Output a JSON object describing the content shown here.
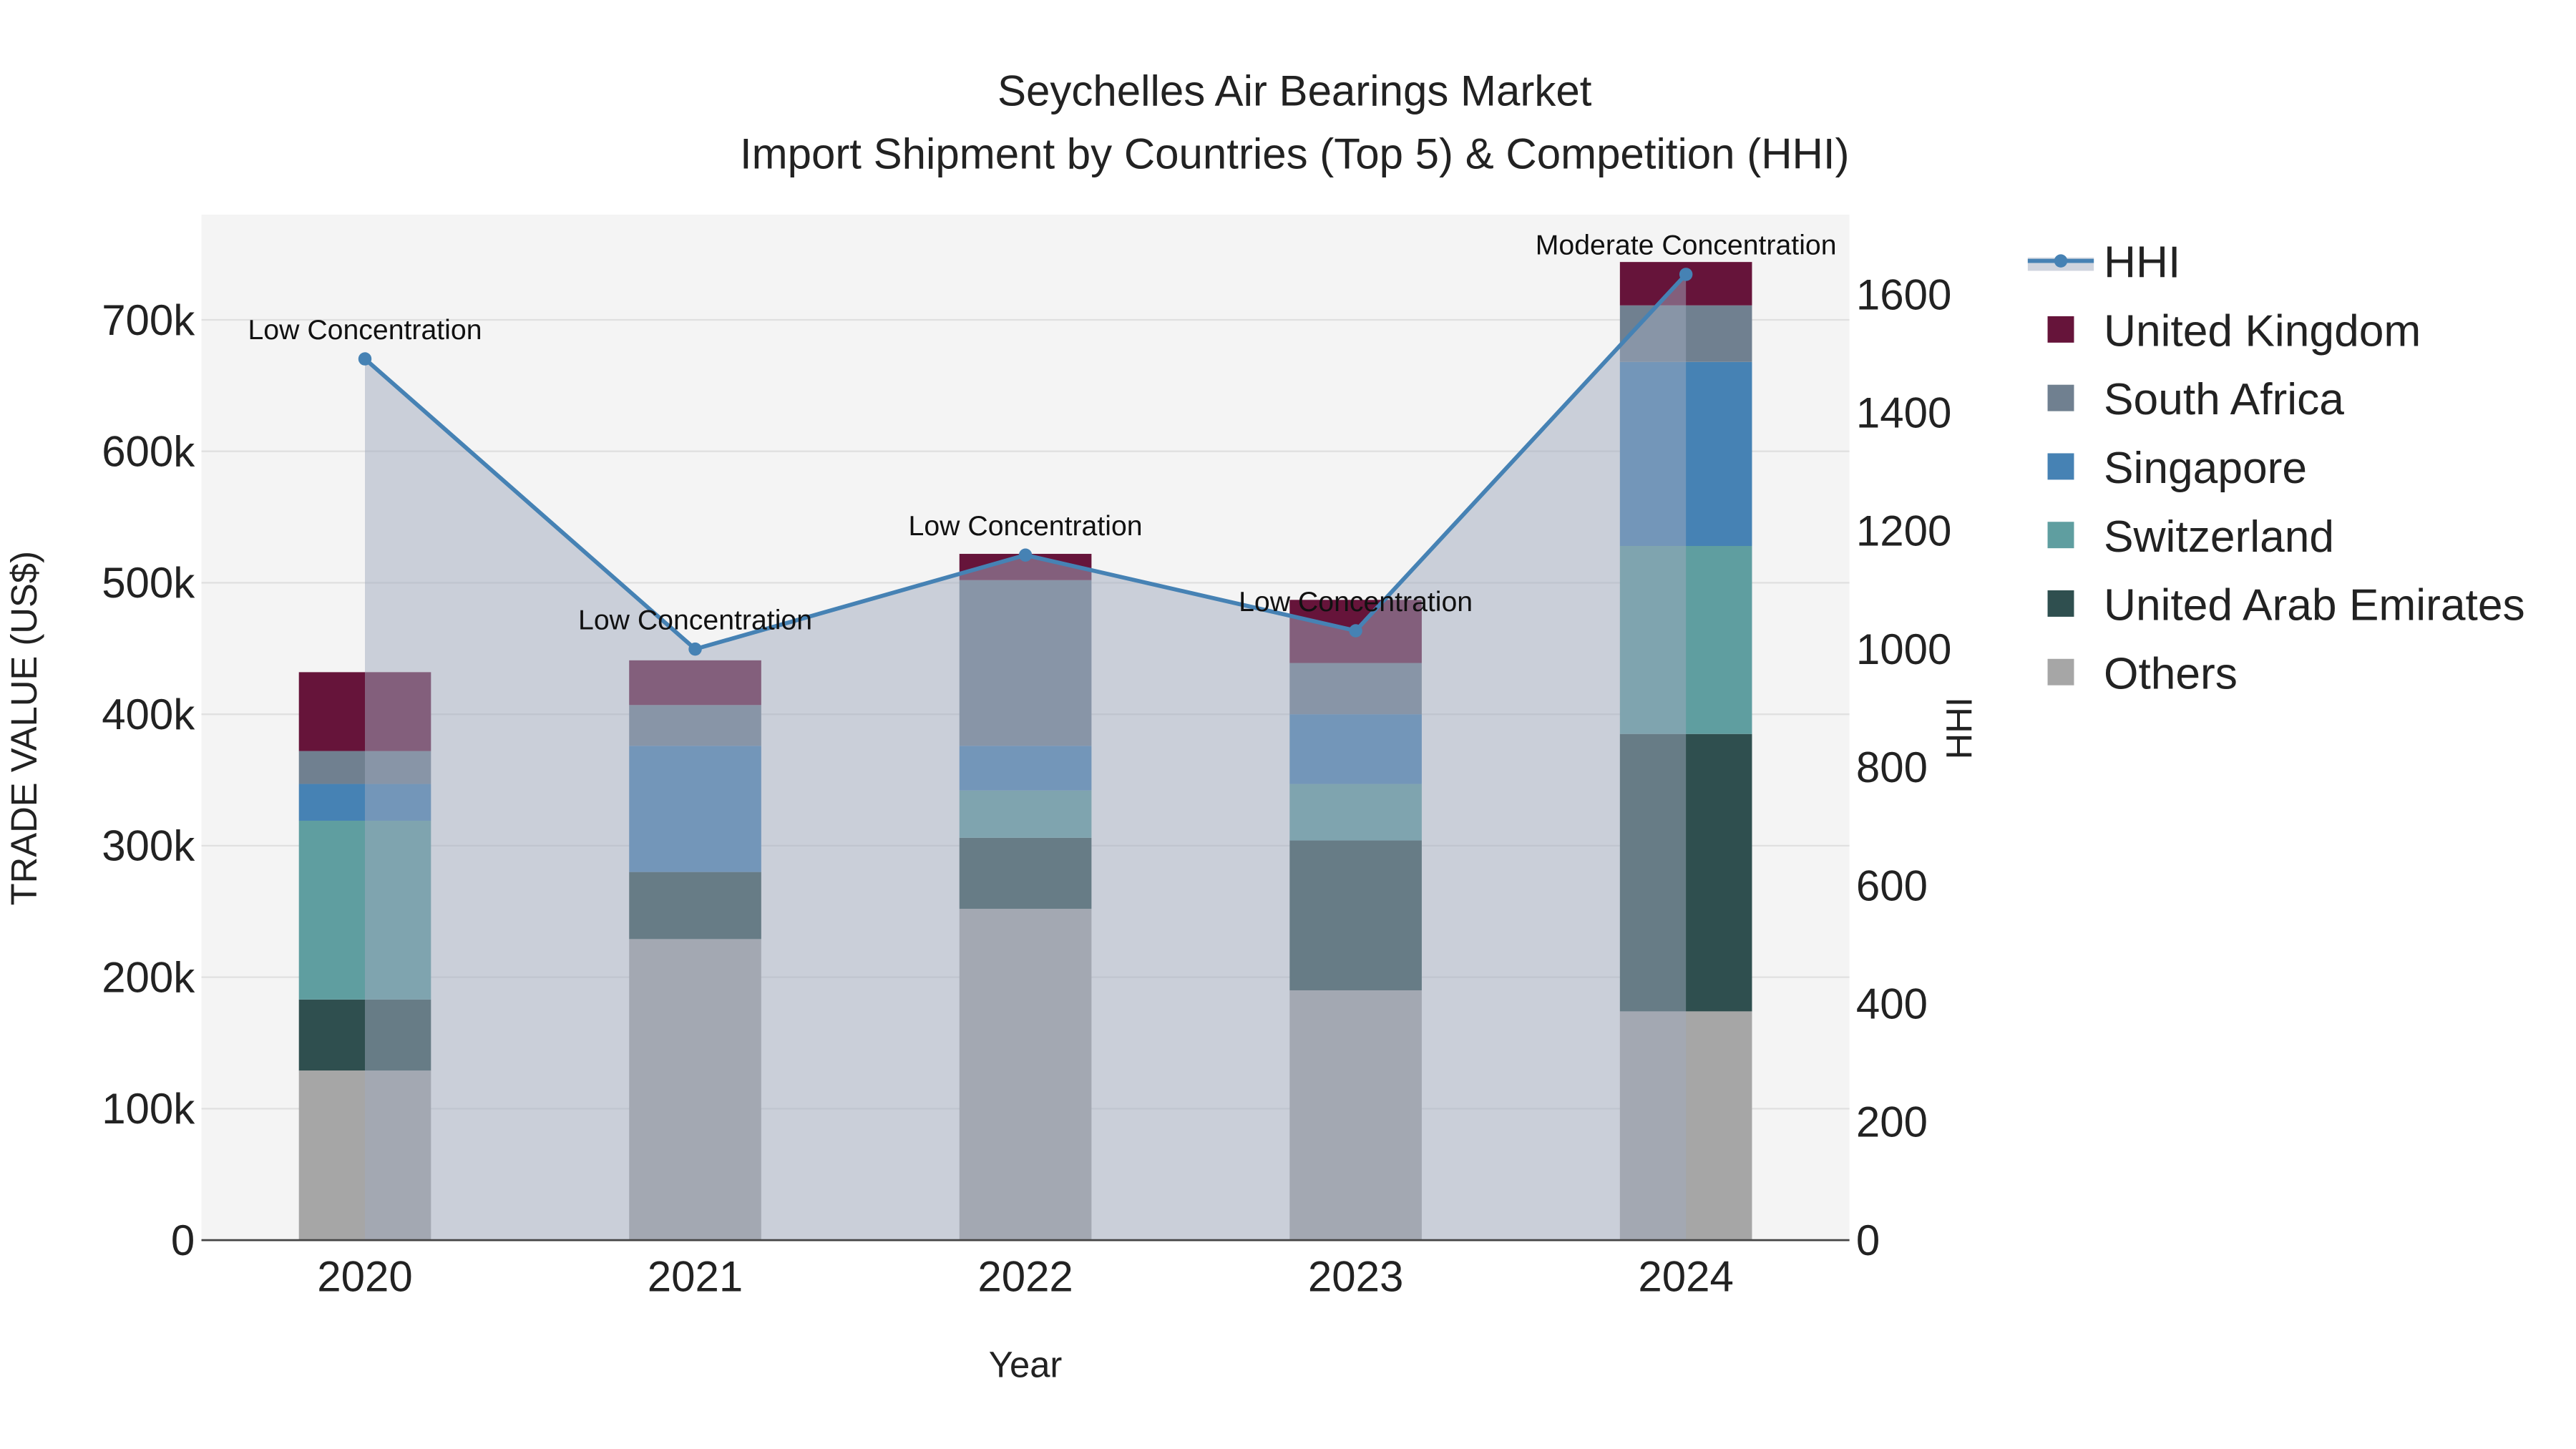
{
  "chart_data": {
    "type": "bar",
    "stacked": true,
    "title": "Seychelles Air Bearings Market",
    "subtitle": "Import Shipment by Countries (Top 5) & Competition (HHI)",
    "xlabel": "Year",
    "ylabel": "TRADE VALUE (US$)",
    "y2label": "HHI",
    "categories": [
      "2020",
      "2021",
      "2022",
      "2023",
      "2024"
    ],
    "ylim": [
      0,
      780000
    ],
    "y_ticks": [
      0,
      100000,
      200000,
      300000,
      400000,
      500000,
      600000,
      700000
    ],
    "y_tick_labels": [
      "0",
      "100k",
      "200k",
      "300k",
      "400k",
      "500k",
      "600k",
      "700k"
    ],
    "y2lim": [
      0,
      1735
    ],
    "y2_ticks": [
      0,
      200,
      400,
      600,
      800,
      1000,
      1200,
      1400,
      1600
    ],
    "y2_tick_labels": [
      "0",
      "200",
      "400",
      "600",
      "800",
      "1000",
      "1200",
      "1400",
      "1600"
    ],
    "series": [
      {
        "name": "Others",
        "color": "#a6a6a6",
        "values": [
          129000,
          229000,
          252000,
          190000,
          174000
        ]
      },
      {
        "name": "United Arab Emirates",
        "color": "#2f4f4f",
        "values": [
          54000,
          51000,
          54000,
          114000,
          211000
        ]
      },
      {
        "name": "Switzerland",
        "color": "#5f9ea0",
        "values": [
          136000,
          0,
          36000,
          43000,
          143000
        ]
      },
      {
        "name": "Singapore",
        "color": "#4682b4",
        "values": [
          28000,
          96000,
          34000,
          53000,
          140000
        ]
      },
      {
        "name": "South Africa",
        "color": "#708090",
        "values": [
          25000,
          31000,
          126000,
          39000,
          43000
        ]
      },
      {
        "name": "United Kingdom",
        "color": "#66143a",
        "values": [
          60000,
          34000,
          20000,
          48000,
          33000
        ]
      }
    ],
    "hhi": {
      "name": "HHI",
      "color": "#4682b4",
      "values": [
        1491,
        1000,
        1159,
        1031,
        1634
      ],
      "annotations": [
        "Low Concentration",
        "Low Concentration",
        "Low Concentration",
        "Low Concentration",
        "Moderate Concentration"
      ]
    },
    "legend": [
      "HHI",
      "United Kingdom",
      "South Africa",
      "Singapore",
      "Switzerland",
      "United Arab Emirates",
      "Others"
    ],
    "legend_placement": "right",
    "grid": true
  }
}
